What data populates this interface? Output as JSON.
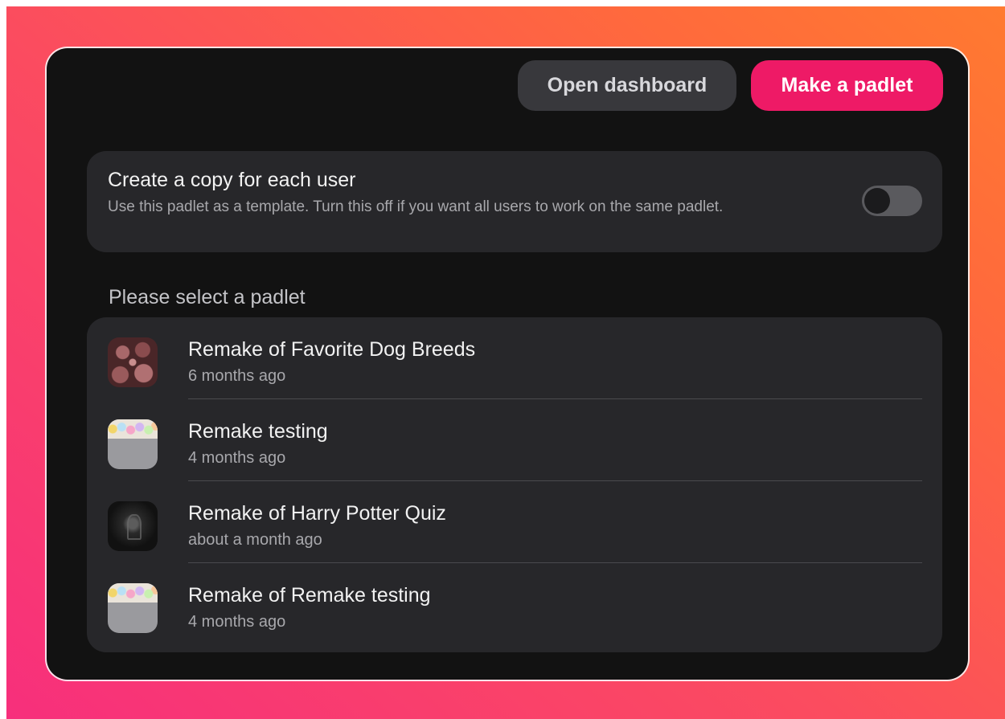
{
  "header": {
    "open_dashboard_label": "Open dashboard",
    "make_padlet_label": "Make a padlet"
  },
  "copy_setting": {
    "title": "Create a copy for each user",
    "description": "Use this padlet as a template. Turn this off if you want all users to work on the same padlet.",
    "enabled": false
  },
  "select_section": {
    "label": "Please select a padlet"
  },
  "padlets": [
    {
      "title": "Remake of Favorite Dog Breeds",
      "time": "6 months ago",
      "thumbnail": "cookies-image"
    },
    {
      "title": "Remake testing",
      "time": "4 months ago",
      "thumbnail": "candy-image"
    },
    {
      "title": "Remake of Harry Potter Quiz",
      "time": "about a month ago",
      "thumbnail": "dark-crest-image"
    },
    {
      "title": "Remake of Remake testing",
      "time": "4 months ago",
      "thumbnail": "candy-image"
    }
  ],
  "colors": {
    "primary": "#ee1a66",
    "panel": "#121212",
    "card": "#27272a"
  }
}
